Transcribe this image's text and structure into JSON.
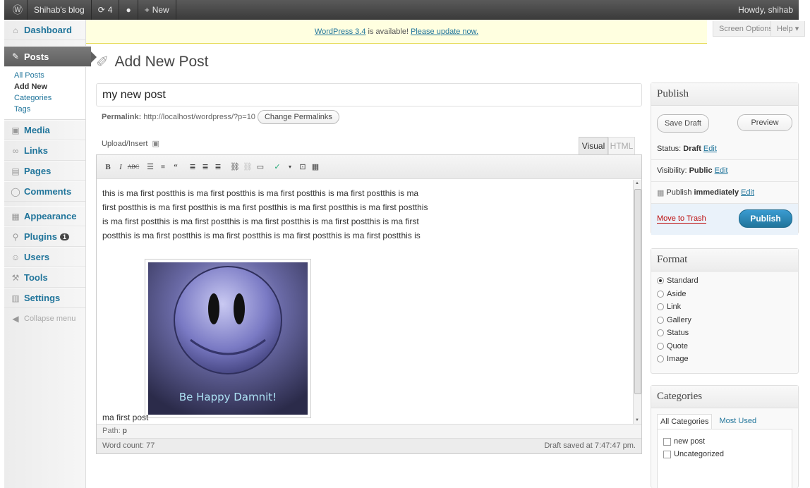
{
  "adminbar": {
    "site_name": "Shihab's blog",
    "updates_count": "4",
    "new_label": "New",
    "howdy": "Howdy, shihab"
  },
  "sidebar": {
    "dashboard": "Dashboard",
    "posts": "Posts",
    "posts_submenu": [
      "All Posts",
      "Add New",
      "Categories",
      "Tags"
    ],
    "media": "Media",
    "links": "Links",
    "pages": "Pages",
    "comments": "Comments",
    "appearance": "Appearance",
    "plugins": "Plugins",
    "plugins_badge": "1",
    "users": "Users",
    "tools": "Tools",
    "settings": "Settings",
    "collapse": "Collapse menu"
  },
  "notice": {
    "update_link": "WordPress 3.4",
    "text": "is available!",
    "cta": "Please update now."
  },
  "screen_options": "Screen Options",
  "help": "Help",
  "page_title": "Add New Post",
  "post": {
    "title": "my new post",
    "permalink_label": "Permalink:",
    "permalink_url": "http://localhost/wordpress/?p=10",
    "change_permalinks": "Change Permalinks",
    "upload_insert": "Upload/Insert",
    "tab_visual": "Visual",
    "tab_html": "HTML",
    "body_lines": [
      "this is ma first postthis is ma first postthis is ma first postthis is ma first postthis is ma",
      "first postthis is ma first postthis is ma first postthis is ma first postthis is ma first postthis",
      "is ma first postthis is ma first postthis is ma first postthis is ma first postthis is ma first",
      "postthis is ma first postthis is ma first postthis is ma first postthis is ma first postthis is"
    ],
    "last_line": "ma first post",
    "image_caption": "Be Happy Damnit!",
    "path_label": "Path:",
    "path_value": "p",
    "word_count": "Word count: 77",
    "draft_saved": "Draft saved at 7:47:47 pm."
  },
  "publish": {
    "title": "Publish",
    "save_draft": "Save Draft",
    "preview": "Preview",
    "status_label": "Status:",
    "status_value": "Draft",
    "visibility_label": "Visibility:",
    "visibility_value": "Public",
    "publish_label": "Publish",
    "publish_value": "immediately",
    "edit": "Edit",
    "move_to_trash": "Move to Trash",
    "publish_button": "Publish"
  },
  "format": {
    "title": "Format",
    "options": [
      "Standard",
      "Aside",
      "Link",
      "Gallery",
      "Status",
      "Quote",
      "Image"
    ],
    "selected": "Standard"
  },
  "categories": {
    "title": "Categories",
    "tab_all": "All Categories",
    "tab_most_used": "Most Used",
    "items": [
      "new post",
      "Uncategorized"
    ]
  }
}
